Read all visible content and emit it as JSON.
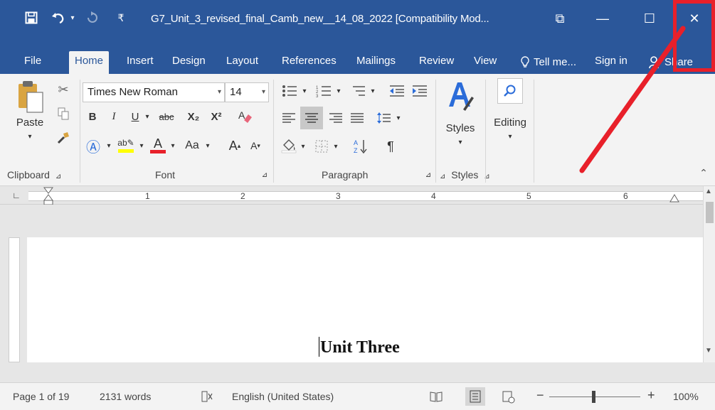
{
  "window": {
    "title": "G7_Unit_3_revised_final_Camb_new__14_08_2022 [Compatibility Mod...",
    "close_symbol": "✕",
    "maximize_symbol": "☐",
    "minimize_symbol": "—",
    "ribbon_display_symbol": "⧉"
  },
  "tabs": {
    "items": [
      "File",
      "Home",
      "Insert",
      "Design",
      "Layout",
      "References",
      "Mailings",
      "Review",
      "View"
    ],
    "active": "Home",
    "tell_me": "Tell me...",
    "sign_in": "Sign in",
    "share": "Share"
  },
  "ribbon": {
    "clipboard": {
      "paste": "Paste",
      "label": "Clipboard"
    },
    "font": {
      "name": "Times New Roman",
      "size": "14",
      "bold": "B",
      "italic": "I",
      "underline": "U",
      "strike": "abc",
      "subscript": "X₂",
      "superscript": "X²",
      "change_case": "Aa",
      "grow": "A",
      "shrink": "A",
      "font_color_letter": "A",
      "label": "Font"
    },
    "paragraph": {
      "label": "Paragraph",
      "pilcrow": "¶"
    },
    "styles": {
      "button": "Styles",
      "label": "Styles"
    },
    "editing": {
      "button": "Editing"
    }
  },
  "ruler": {
    "numbers": [
      "1",
      "2",
      "3",
      "4",
      "5",
      "6"
    ]
  },
  "document": {
    "heading": "Unit Three"
  },
  "status": {
    "page": "Page 1 of 19",
    "words": "2131 words",
    "language": "English (United States)",
    "zoom": "100%",
    "zoom_minus": "−",
    "zoom_plus": "+"
  },
  "colors": {
    "title_bar": "#2b579a",
    "annotation": "#e8202a",
    "font_color_underline": "#e8202a",
    "highlight_yellow": "#ffff00"
  }
}
